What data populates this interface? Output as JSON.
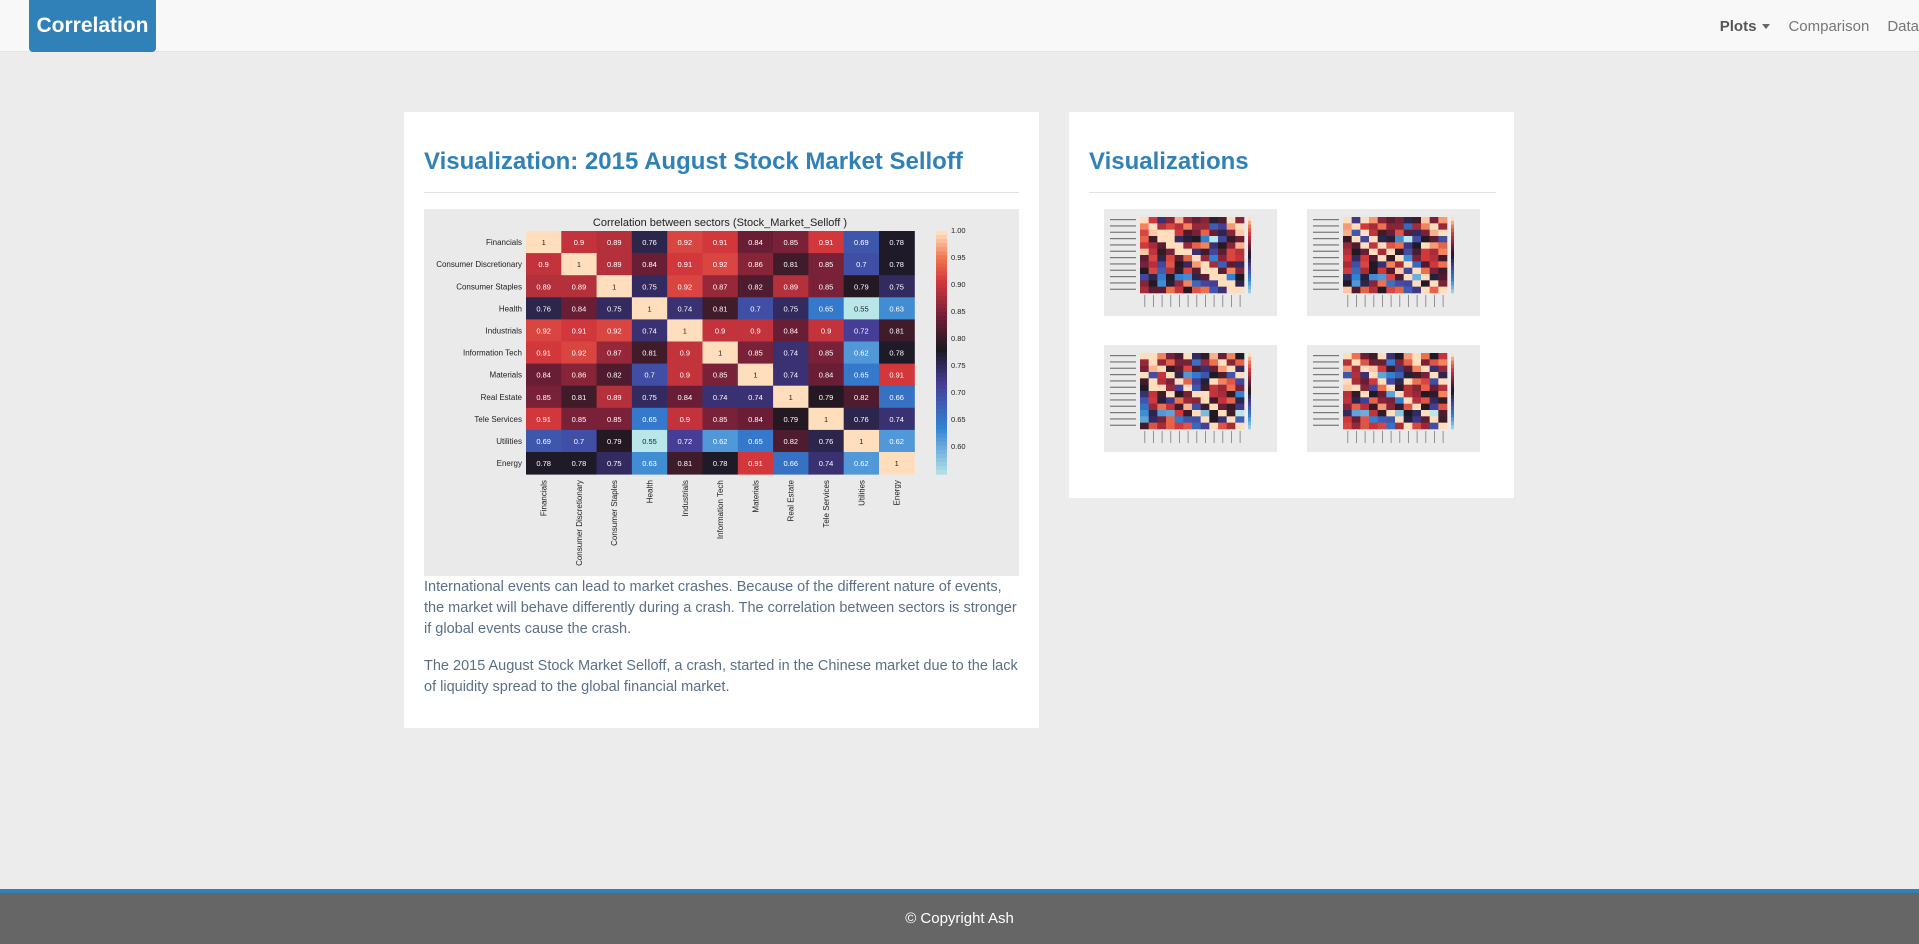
{
  "brand": "Correlation",
  "nav": {
    "plots_label": "Plots",
    "comparison_label": "Comparison",
    "data_label": "Data"
  },
  "main": {
    "title": "Visualization: 2015 August Stock Market Selloff",
    "paragraphs": [
      "International events can lead to market crashes. Because of the different nature of events, the market will behave differently during a crash. The correlation between sectors is stronger if global events cause the crash.",
      "The 2015 August Stock Market Selloff, a crash, started in the Chinese market due to the lack of liquidity spread to the global financial market."
    ]
  },
  "side": {
    "title": "Visualizations"
  },
  "footer": {
    "copyright": "© Copyright Ash"
  },
  "chart_data": {
    "type": "heatmap",
    "title": "Correlation between sectors (Stock_Market_Selloff )",
    "labels": [
      "Financials",
      "Consumer Discretionary",
      "Consumer Staples",
      "Health",
      "Industrials",
      "Information Tech",
      "Materials",
      "Real Estate",
      "Tele Services",
      "Utilities",
      "Energy"
    ],
    "values": [
      [
        1,
        0.9,
        0.89,
        0.76,
        0.92,
        0.91,
        0.84,
        0.85,
        0.91,
        0.69,
        0.78
      ],
      [
        0.9,
        1,
        0.89,
        0.84,
        0.91,
        0.92,
        0.86,
        0.81,
        0.85,
        0.7,
        0.78
      ],
      [
        0.89,
        0.89,
        1,
        0.75,
        0.92,
        0.87,
        0.82,
        0.89,
        0.85,
        0.79,
        0.75
      ],
      [
        0.76,
        0.84,
        0.75,
        1,
        0.74,
        0.81,
        0.7,
        0.75,
        0.65,
        0.55,
        0.63
      ],
      [
        0.92,
        0.91,
        0.92,
        0.74,
        1,
        0.9,
        0.9,
        0.84,
        0.9,
        0.72,
        0.81
      ],
      [
        0.91,
        0.92,
        0.87,
        0.81,
        0.9,
        1,
        0.85,
        0.74,
        0.85,
        0.62,
        0.78
      ],
      [
        0.84,
        0.86,
        0.82,
        0.7,
        0.9,
        0.85,
        1,
        0.74,
        0.84,
        0.65,
        0.91
      ],
      [
        0.85,
        0.81,
        0.89,
        0.75,
        0.84,
        0.74,
        0.74,
        1,
        0.79,
        0.82,
        0.66
      ],
      [
        0.91,
        0.85,
        0.85,
        0.65,
        0.9,
        0.85,
        0.84,
        0.79,
        1,
        0.76,
        0.74
      ],
      [
        0.69,
        0.7,
        0.79,
        0.55,
        0.72,
        0.62,
        0.65,
        0.82,
        0.76,
        1,
        0.62
      ],
      [
        0.78,
        0.78,
        0.75,
        0.63,
        0.81,
        0.78,
        0.91,
        0.66,
        0.74,
        0.62,
        1
      ]
    ],
    "colorbar_ticks": [
      "1.00",
      "0.95",
      "0.90",
      "0.85",
      "0.80",
      "0.75",
      "0.70",
      "0.65",
      "0.60"
    ],
    "vmin": 0.55,
    "vmax": 1.0
  }
}
